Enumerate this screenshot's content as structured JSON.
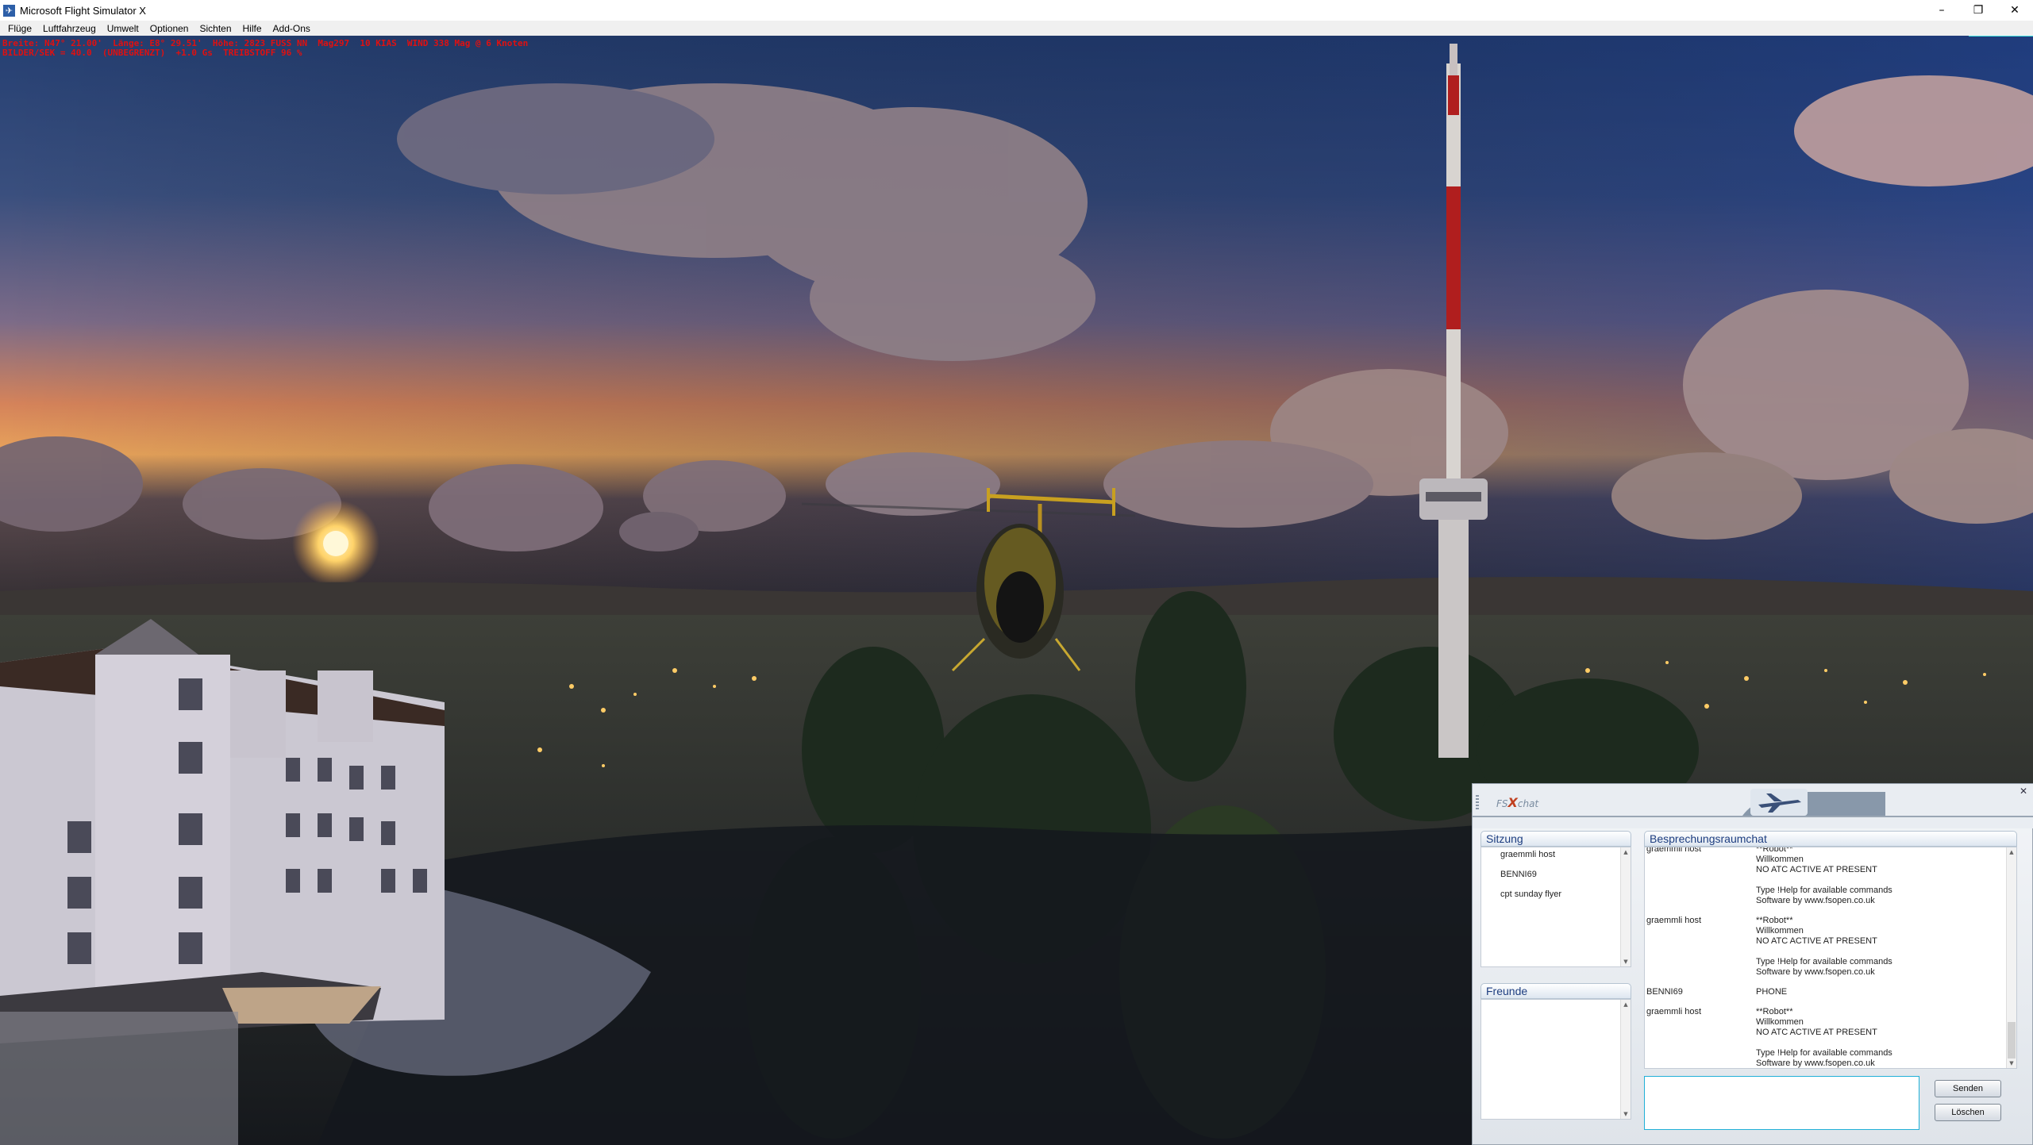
{
  "window": {
    "title": "Microsoft Flight Simulator X",
    "min": "–",
    "restore": "❐",
    "close": "✕"
  },
  "menu": [
    "Flüge",
    "Luftfahrzeug",
    "Umwelt",
    "Optionen",
    "Sichten",
    "Hilfe",
    "Add-Ons"
  ],
  "hud": {
    "line1": "Breite: N47° 21.00'  Länge: E8° 29.51'  Höhe: 2823 FUSS NN  Mag297  10 KIAS  WIND 338 Mag @ 6 Knoten",
    "line2": "BILDER/SEK = 40.0  (UNBEGRENZT)  +1.0 Gs  TREIBSTOFF 96 %"
  },
  "chat": {
    "logo_fs": "FS",
    "logo_x": "X",
    "logo_chat": "chat",
    "close": "✕",
    "session_title": "Sitzung",
    "session_users": [
      "graemmli host",
      "BENNI69",
      "cpt sunday flyer"
    ],
    "friends_title": "Freunde",
    "room_title": "Besprechungsraumchat",
    "messages": [
      {
        "name": "graemmli host",
        "lines": [
          "**Robot**",
          "Willkommen",
          "NO ATC ACTIVE AT PRESENT",
          "",
          "Type !Help for available commands",
          "Software by www.fsopen.co.uk"
        ]
      },
      {
        "name": "graemmli host",
        "lines": [
          "**Robot**",
          "Willkommen",
          "NO ATC ACTIVE AT PRESENT",
          "",
          "Type !Help for available commands",
          "Software by www.fsopen.co.uk"
        ]
      },
      {
        "name": "BENNI69",
        "lines": [
          "PHONE"
        ]
      },
      {
        "name": "graemmli host",
        "lines": [
          "**Robot**",
          "Willkommen",
          "NO ATC ACTIVE AT PRESENT",
          "",
          "Type !Help for available commands",
          "Software by www.fsopen.co.uk"
        ]
      }
    ],
    "input_value": "",
    "send_label": "Senden",
    "clear_label": "Löschen",
    "scroll_up": "▲",
    "scroll_down": "▼"
  },
  "colors": {
    "hud": "#e01010",
    "accent": "#1e3e80",
    "input_border": "#20b0d8"
  }
}
